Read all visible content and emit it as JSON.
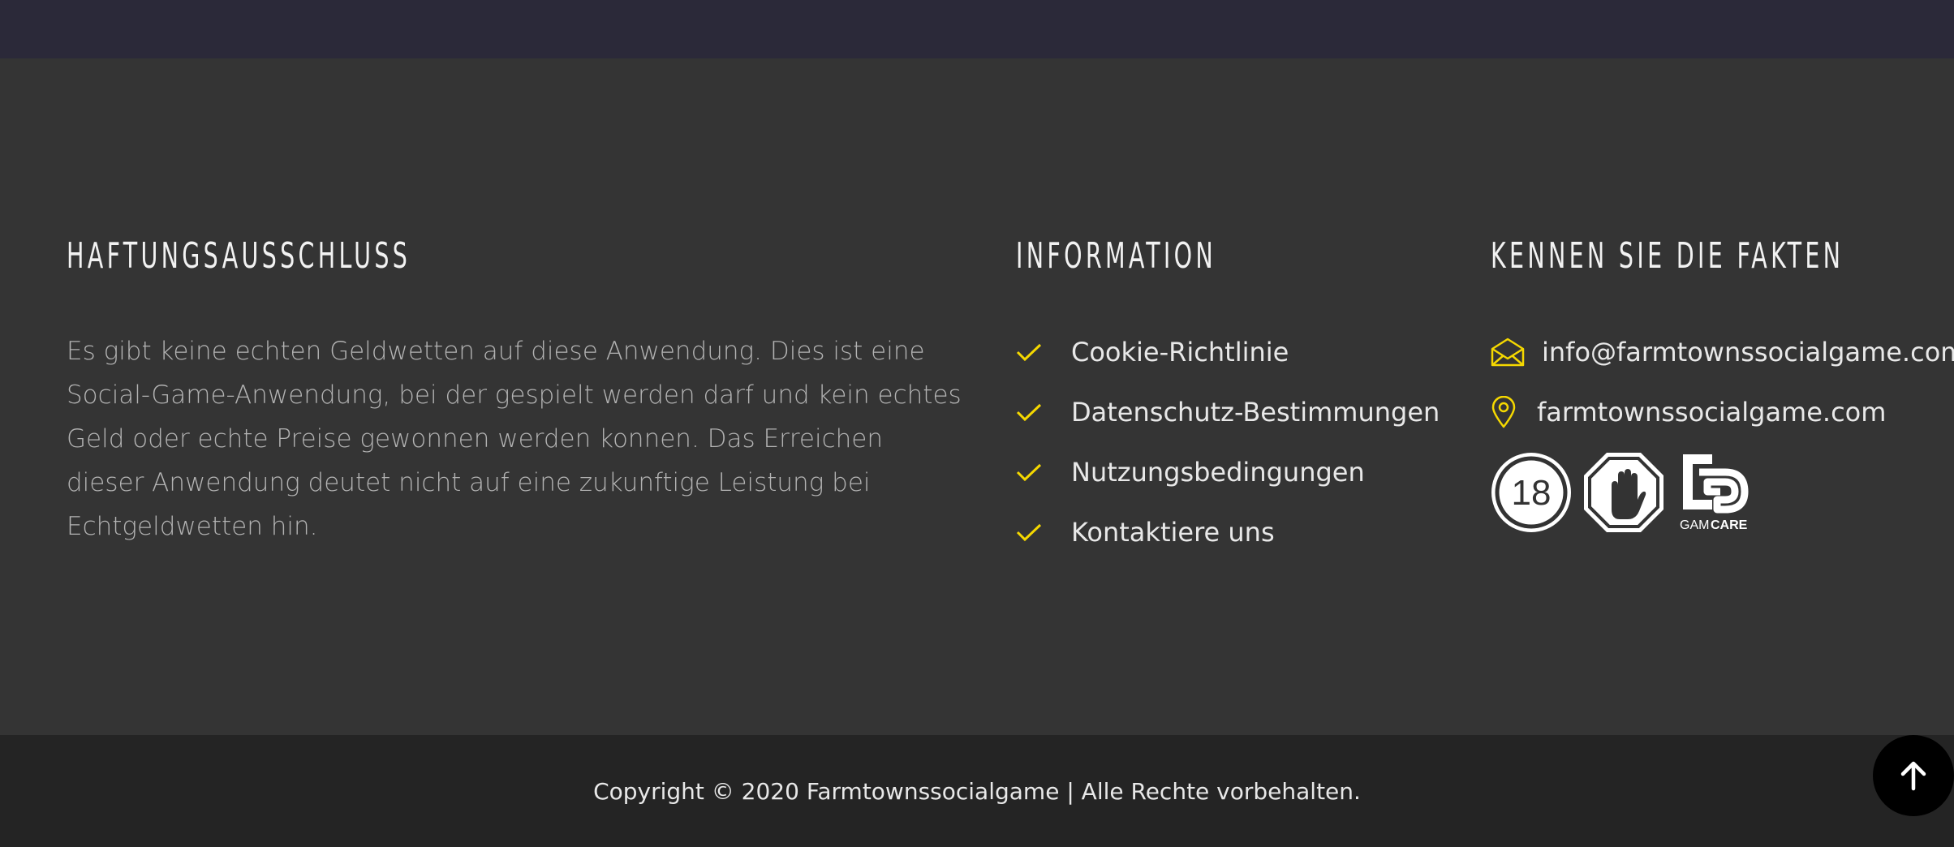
{
  "colors": {
    "top_band": "#2b2939",
    "footer_background": "#343434",
    "bottom_bar": "#242424",
    "accent": "#f5d800",
    "scroll_button": "#000000"
  },
  "disclaimer": {
    "heading": "HAFTUNGSAUSSCHLUSS",
    "text": "Es gibt keine echten Geldwetten auf diese Anwendung. Dies ist eine Social-Game-Anwendung, bei der gespielt werden darf und kein echtes Geld oder echte Preise gewonnen werden konnen. Das Erreichen dieser Anwendung deutet nicht auf eine zukunftige Leistung bei Echtgeldwetten hin."
  },
  "information": {
    "heading": "INFORMATION",
    "links": [
      {
        "label": "Cookie-Richtlinie",
        "icon": "check-icon"
      },
      {
        "label": "Datenschutz-Bestimmungen",
        "icon": "check-icon"
      },
      {
        "label": "Nutzungsbedingungen",
        "icon": "check-icon"
      },
      {
        "label": "Kontaktiere uns",
        "icon": "check-icon"
      }
    ]
  },
  "facts": {
    "heading": "KENNEN SIE DIE FAKTEN",
    "email": {
      "icon": "envelope-icon",
      "label": "info@farmtownssocialgame.com"
    },
    "website": {
      "icon": "map-pin-icon",
      "label": "farmtownssocialgame.com"
    },
    "badges": [
      {
        "name": "age-18-badge",
        "text": "18"
      },
      {
        "name": "stop-hand-badge"
      },
      {
        "name": "gamcare-badge",
        "text_a": "GAM",
        "text_b": "CARE"
      }
    ]
  },
  "footer": {
    "copyright": "Copyright © 2020 Farmtownssocialgame | Alle Rechte vorbehalten."
  },
  "scroll_top": {
    "icon": "arrow-up-icon"
  }
}
